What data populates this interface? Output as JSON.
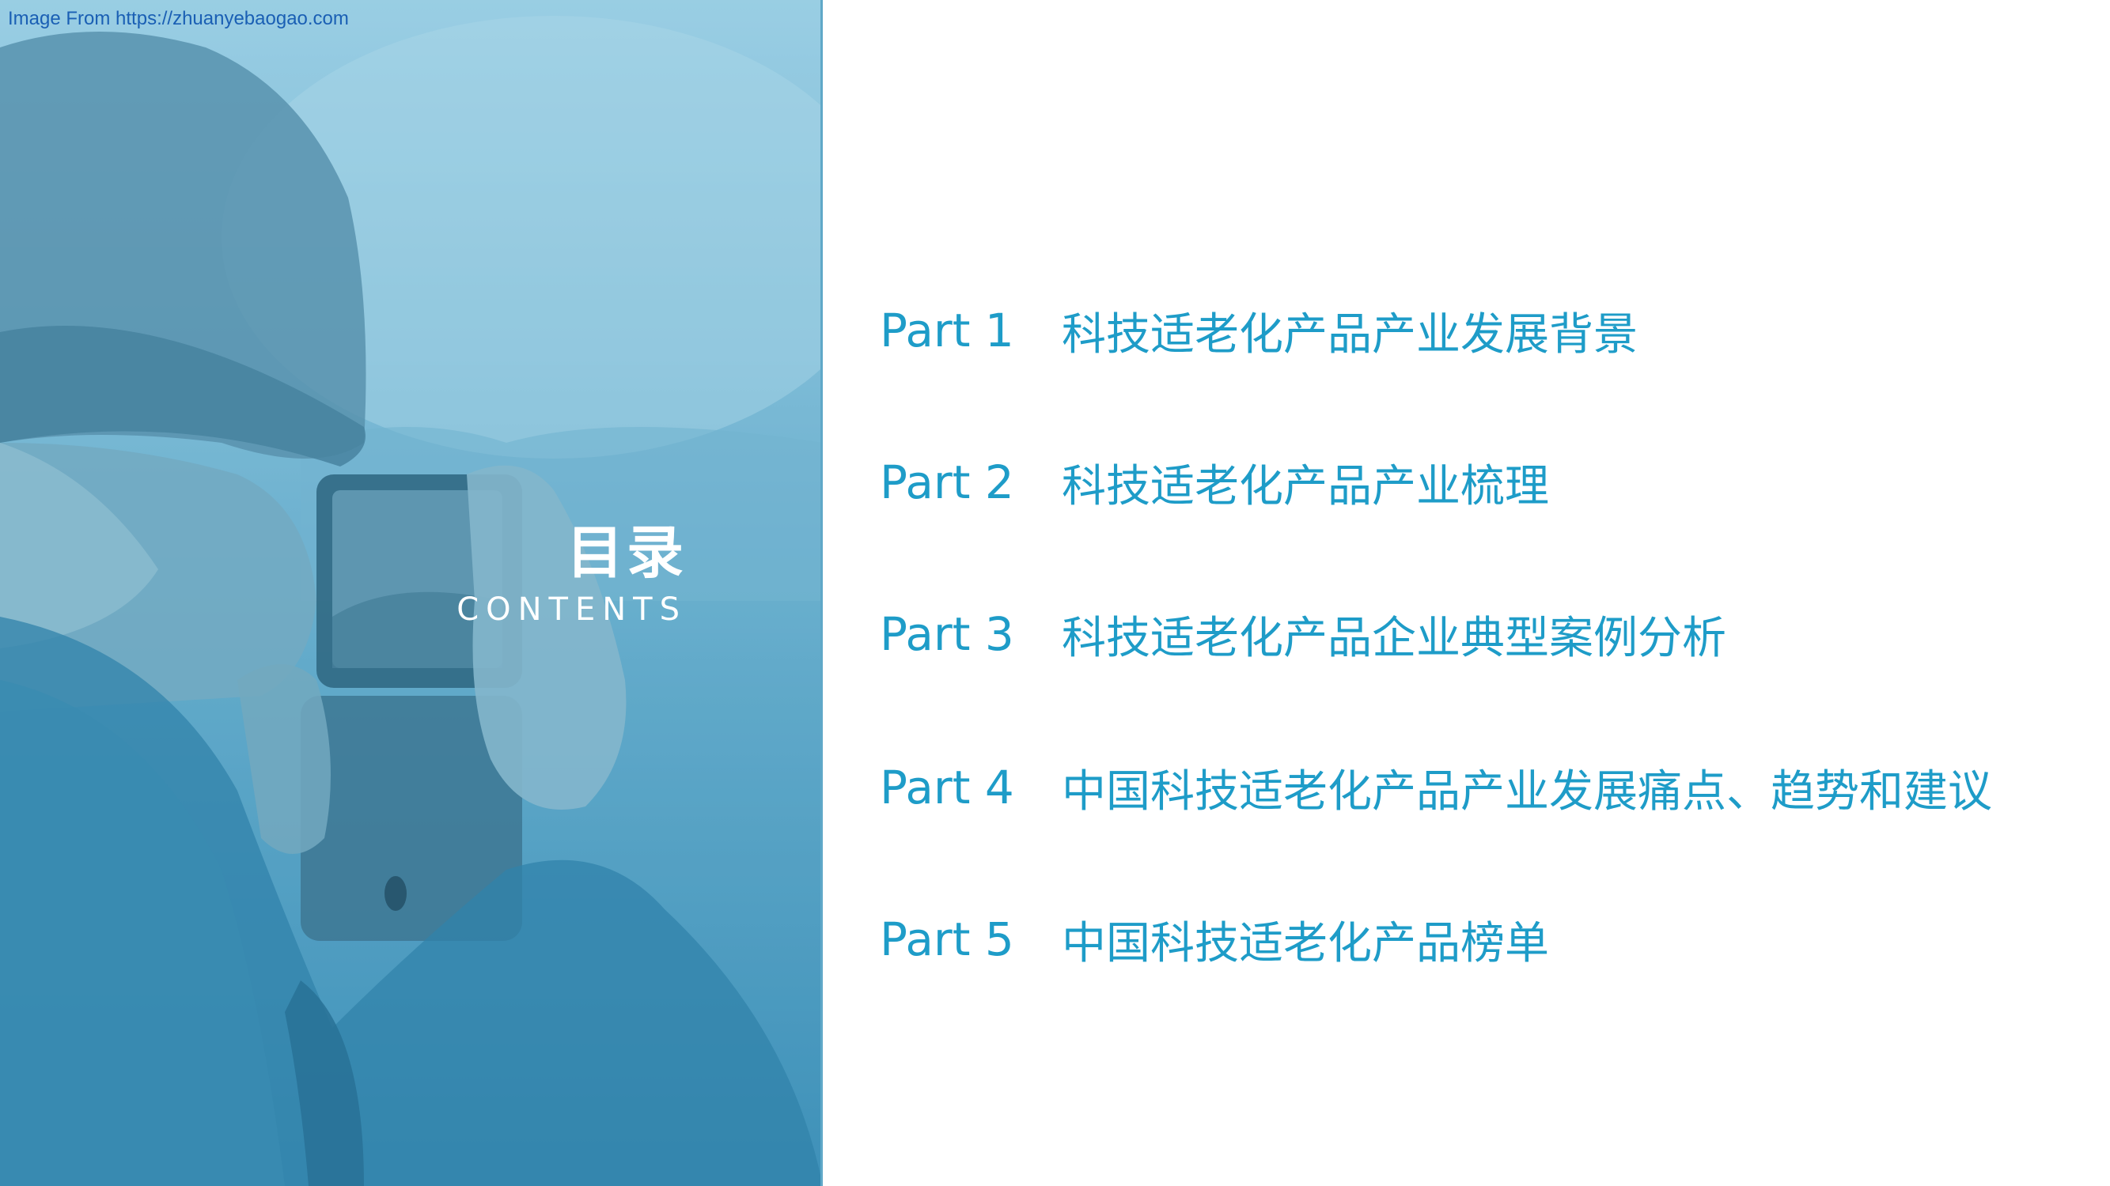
{
  "watermark": "Image From https://zhuanyebaogao.com",
  "toc": {
    "title": "目录",
    "subtitle": "CONTENTS",
    "items": [
      {
        "part": "Part 1",
        "text": "科技适老化产品产业发展背景"
      },
      {
        "part": "Part 2",
        "text": "科技适老化产品产业梳理"
      },
      {
        "part": "Part 3",
        "text": "科技适老化产品企业典型案例分析"
      },
      {
        "part": "Part 4",
        "text": "中国科技适老化产品产业发展痛点、趋势和建议"
      },
      {
        "part": "Part 5",
        "text": "中国科技适老化产品榜单"
      }
    ]
  },
  "colors": {
    "accent": "#1e9cc8",
    "panel_top": "#aed9ea",
    "panel_bottom": "#3f8fb6",
    "watermark": "#1a5fb4"
  },
  "image": {
    "description_icon": "elderly-man-taking-photo"
  }
}
